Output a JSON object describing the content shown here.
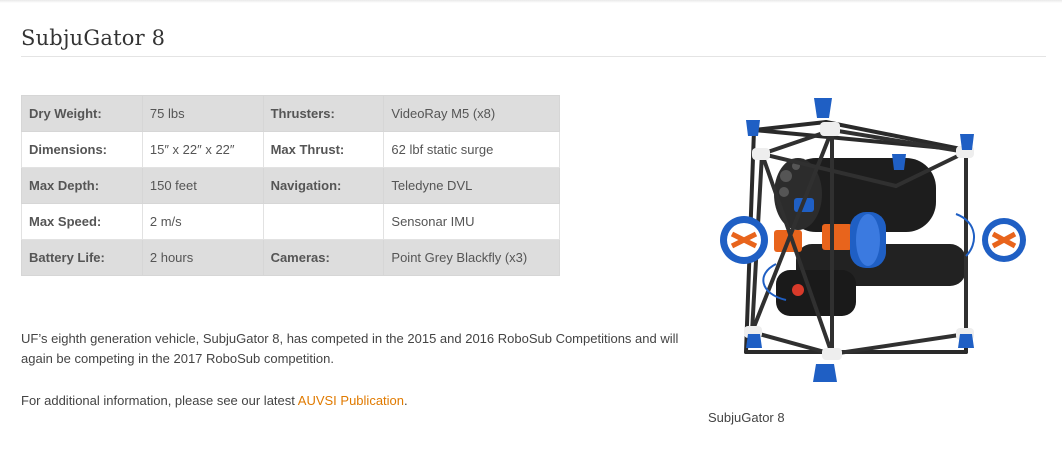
{
  "page": {
    "title": "SubjuGator 8"
  },
  "specs": {
    "rows": [
      {
        "label_a": "Dry Weight:",
        "value_a": "75 lbs",
        "label_b": "Thrusters:",
        "value_b": "VideoRay M5 (x8)"
      },
      {
        "label_a": "Dimensions:",
        "value_a": "15″ x 22″ x 22″",
        "label_b": "Max Thrust:",
        "value_b": "62 lbf static surge"
      },
      {
        "label_a": "Max Depth:",
        "value_a": "150 feet",
        "label_b": "Navigation:",
        "value_b": "Teledyne DVL"
      },
      {
        "label_a": "Max Speed:",
        "value_a": "2 m/s",
        "label_b": "",
        "value_b": "Sensonar IMU"
      },
      {
        "label_a": "Battery Life:",
        "value_a": "2 hours",
        "label_b": "Cameras:",
        "value_b": "Point Grey Blackfly (x3)"
      }
    ]
  },
  "description": {
    "paragraph": "UF’s eighth generation vehicle, SubjuGator 8, has competed in the 2015 and 2016 RoboSub Competitions and will again be competing in the 2017 RoboSub competition.",
    "info_prefix": "For additional information, please see our latest ",
    "info_link": "AUVSI Publication",
    "info_suffix": "."
  },
  "figure": {
    "caption": "SubjuGator 8",
    "colors": {
      "accent": "#e07a00",
      "thruster_blue": "#1f5fc4",
      "thruster_orange": "#e8641c"
    }
  }
}
